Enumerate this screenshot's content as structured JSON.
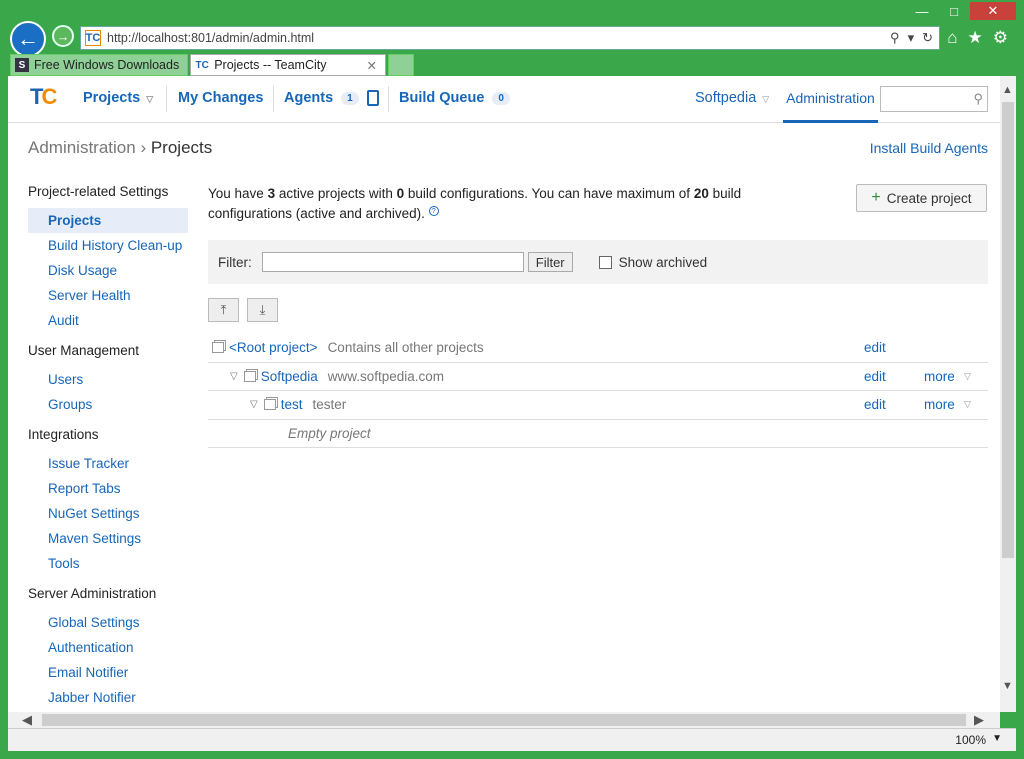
{
  "browser": {
    "url": "http://localhost:801/admin/admin.html",
    "tabs": [
      {
        "label": "Free Windows Downloads",
        "favicon": "S"
      },
      {
        "label": "Projects -- TeamCity",
        "favicon": "TC",
        "active": true
      }
    ],
    "zoom": "100%"
  },
  "header": {
    "logo": "TC",
    "projects": "Projects",
    "my_changes": "My Changes",
    "agents": "Agents",
    "agents_count": "1",
    "build_queue": "Build Queue",
    "build_queue_count": "0",
    "user": "Softpedia",
    "administration": "Administration"
  },
  "breadcrumb": {
    "root": "Administration",
    "current": "Projects"
  },
  "install_agents": "Install Build Agents",
  "sidebar": {
    "groups": [
      {
        "title": "Project-related Settings",
        "items": [
          "Projects",
          "Build History Clean-up",
          "Disk Usage",
          "Server Health",
          "Audit"
        ]
      },
      {
        "title": "User Management",
        "items": [
          "Users",
          "Groups"
        ]
      },
      {
        "title": "Integrations",
        "items": [
          "Issue Tracker",
          "Report Tabs",
          "NuGet Settings",
          "Maven Settings",
          "Tools"
        ]
      },
      {
        "title": "Server Administration",
        "items": [
          "Global Settings",
          "Authentication",
          "Email Notifier",
          "Jabber Notifier"
        ]
      }
    ]
  },
  "main": {
    "intro_a": "You have ",
    "active_count": "3",
    "intro_b": " active projects with ",
    "config_count": "0",
    "intro_c": " build configurations. You can have maximum of ",
    "max_configs": "20",
    "intro_d": " build configurations (active and archived).",
    "create_project": "Create project",
    "filter_label": "Filter:",
    "filter_button": "Filter",
    "show_archived": "Show archived",
    "rows": [
      {
        "name": "<Root project>",
        "desc": "Contains all other projects",
        "edit": "edit"
      },
      {
        "name": "Softpedia",
        "desc": "www.softpedia.com",
        "edit": "edit",
        "more": "more"
      },
      {
        "name": "test",
        "desc": "tester",
        "edit": "edit",
        "more": "more"
      }
    ],
    "empty_label": "Empty project"
  }
}
